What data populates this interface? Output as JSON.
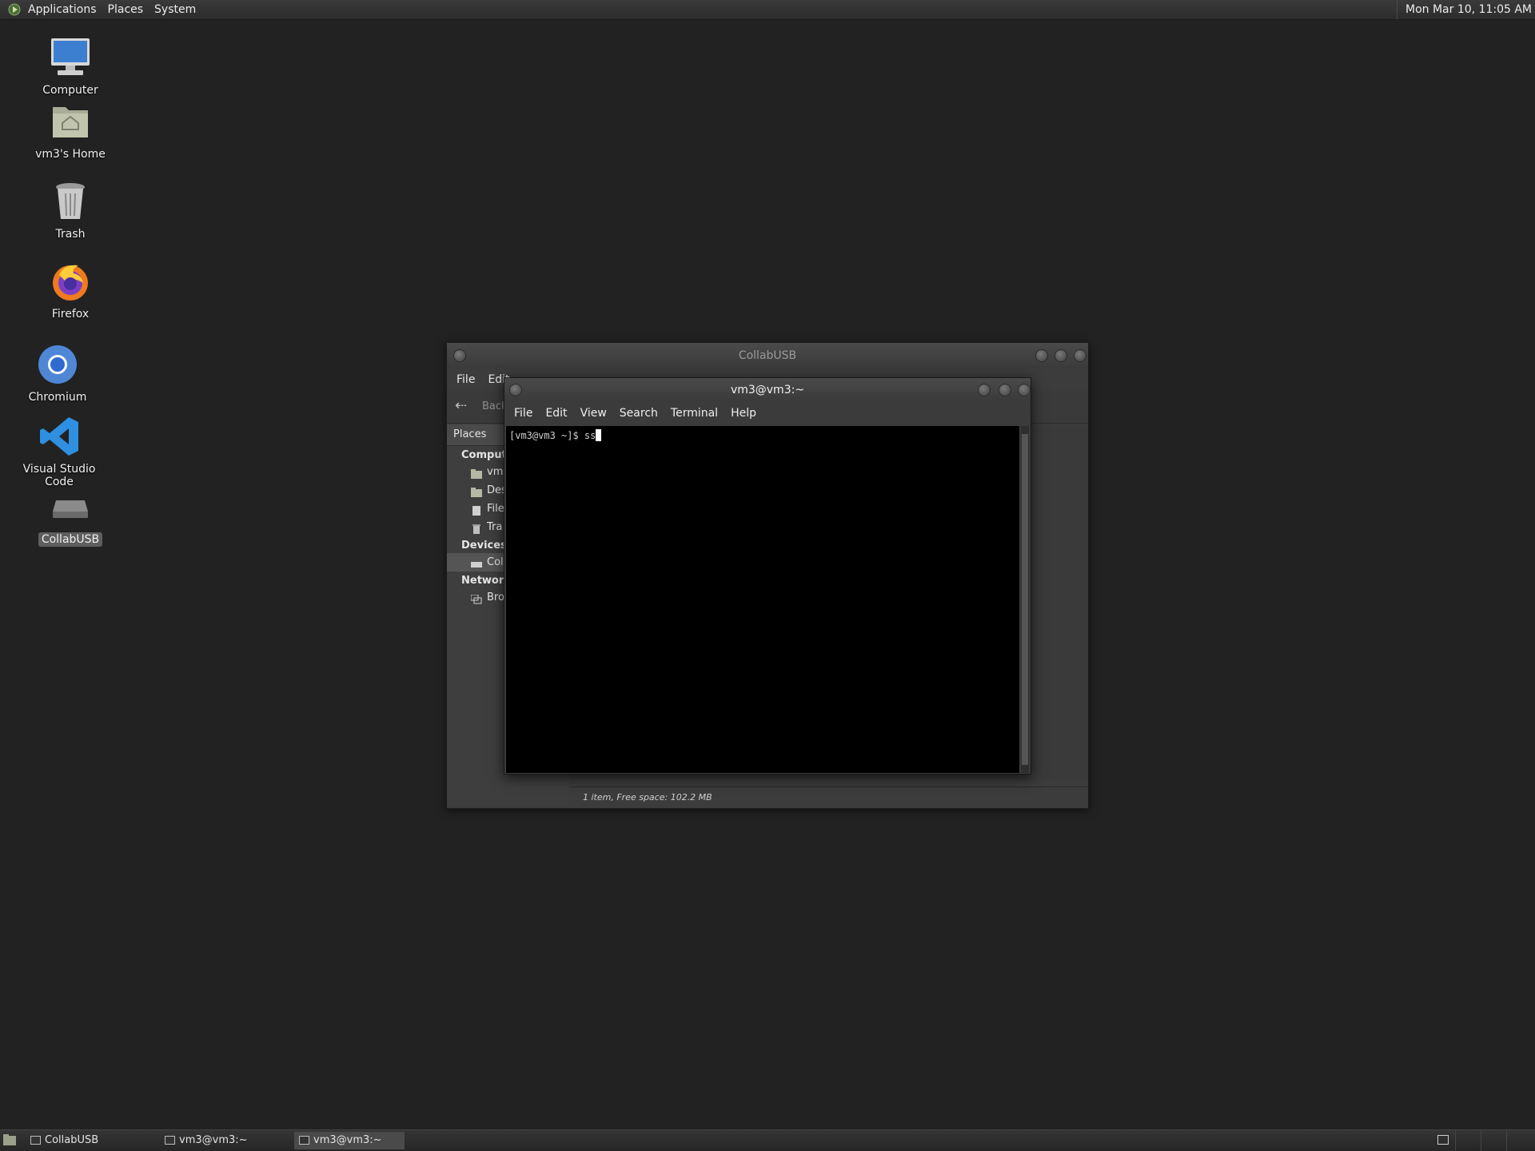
{
  "top_panel": {
    "menu": [
      "Applications",
      "Places",
      "System"
    ],
    "clock": "Mon Mar 10, 11:05 AM"
  },
  "desktop_icons": [
    {
      "label": "Computer",
      "icon": "computer-icon"
    },
    {
      "label": "vm3's Home",
      "icon": "home-folder-icon"
    },
    {
      "label": "Trash",
      "icon": "trash-icon"
    },
    {
      "label": "Firefox",
      "icon": "firefox-icon"
    },
    {
      "label": "Chromium",
      "icon": "chromium-icon"
    },
    {
      "label": "Visual Studio Code",
      "icon": "vscode-icon"
    },
    {
      "label": "CollabUSB",
      "icon": "usb-drive-icon",
      "selected": true
    }
  ],
  "file_manager": {
    "title": "CollabUSB",
    "menu": [
      "File",
      "Edit"
    ],
    "toolbar_back": "Back",
    "sidebar_header": "Places",
    "sections": {
      "computer": "Comput",
      "devices": "Devices",
      "network": "Network"
    },
    "computer_items": [
      "vm",
      "Des",
      "File",
      "Tra"
    ],
    "device_items": [
      "Col"
    ],
    "network_items": [
      "Bro"
    ],
    "status": "1 item, Free space: 102.2 MB"
  },
  "terminal": {
    "title": "vm3@vm3:~",
    "menu": [
      "File",
      "Edit",
      "View",
      "Search",
      "Terminal",
      "Help"
    ],
    "prompt": "[vm3@vm3 ~]$ ss"
  },
  "taskbar": {
    "tasks": [
      {
        "label": "CollabUSB",
        "active": false
      },
      {
        "label": "vm3@vm3:~",
        "active": false
      },
      {
        "label": "vm3@vm3:~",
        "active": true
      }
    ]
  },
  "colors": {
    "desktop_bg": "#222222",
    "panel_bg": "#2f2f2f",
    "terminal_bg": "#000000",
    "vscode_blue": "#2f8fe0",
    "firefox_orange": "#f07a1f"
  }
}
